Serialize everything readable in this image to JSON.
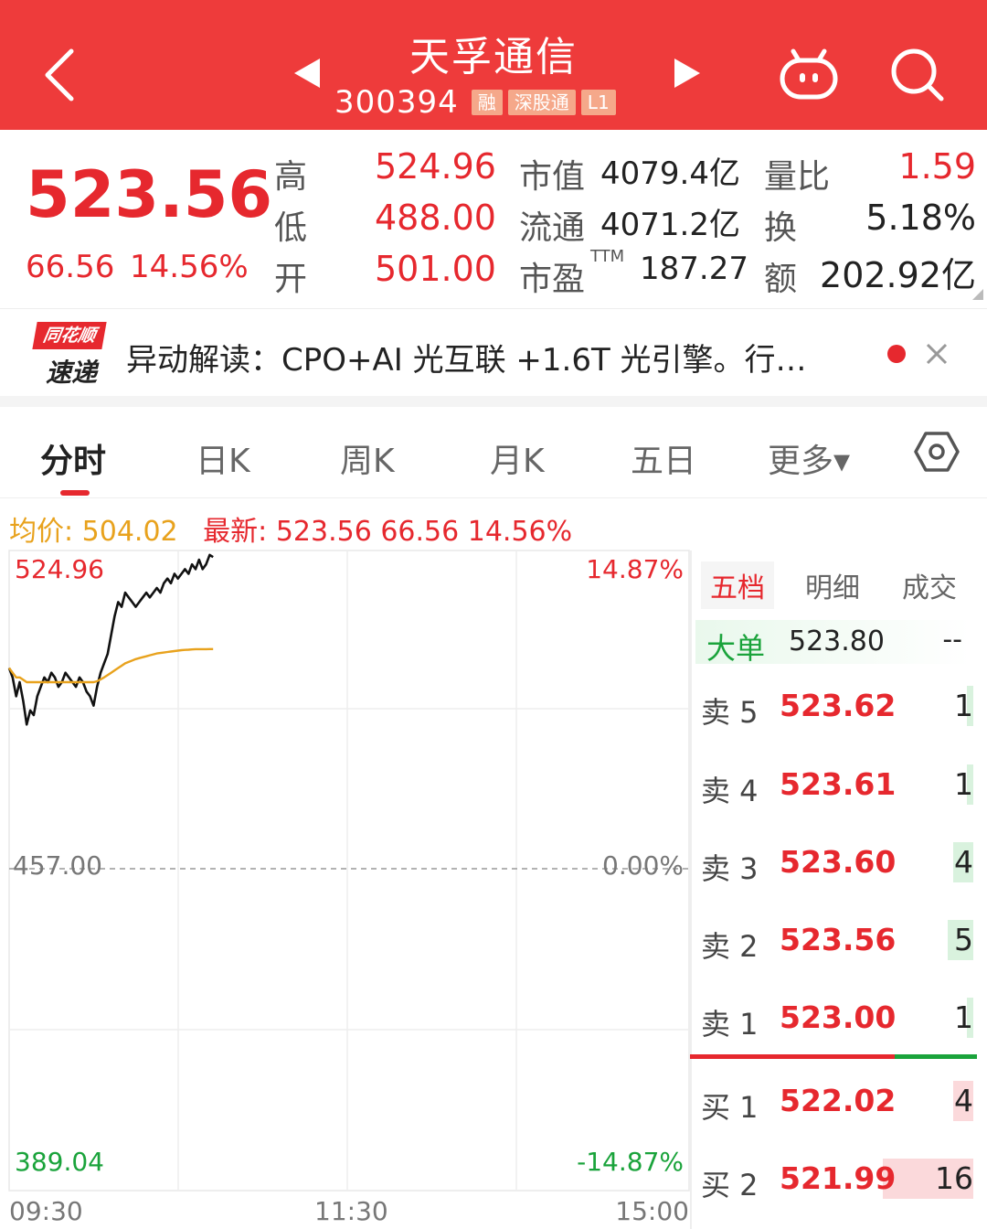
{
  "header": {
    "title": "天孚通信",
    "code": "300394",
    "tags": [
      "融",
      "深股通",
      "L1"
    ]
  },
  "quote": {
    "price": "523.56",
    "change": "66.56",
    "change_pct": "14.56%",
    "high_label": "高",
    "high": "524.96",
    "low_label": "低",
    "low": "488.00",
    "open_label": "开",
    "open": "501.00",
    "mktcap_label": "市值",
    "mktcap": "4079.4亿",
    "float_label": "流通",
    "float": "4071.2亿",
    "pe_label": "市盈",
    "pe_sup": "TTM",
    "pe": "187.27",
    "volratio_label": "量比",
    "volratio": "1.59",
    "turnover_label": "换",
    "turnover": "5.18%",
    "amount_label": "额",
    "amount": "202.92亿"
  },
  "news": {
    "logo_top": "同花顺",
    "logo_bottom": "速递",
    "text": "异动解读：CPO+AI 光互联 +1.6T 光引擎。行…"
  },
  "tabs": [
    "分时",
    "日K",
    "周K",
    "月K",
    "五日",
    "更多▾"
  ],
  "legend": {
    "avg": "均价: 504.02",
    "last": "最新: 523.56  66.56  14.56%"
  },
  "chart_data": {
    "type": "line",
    "y_top_label": "524.96",
    "y_mid_label": "457.00",
    "y_bottom_label": "389.04",
    "pct_top_label": "14.87%",
    "pct_mid_label": "0.00%",
    "pct_bottom_label": "-14.87%",
    "x_labels": [
      "09:30",
      "11:30",
      "15:00"
    ],
    "ylim": [
      389.04,
      524.96
    ],
    "prev_close": 457.0,
    "series": [
      {
        "color": "#111111",
        "values": [
          500,
          498,
          494,
          497,
          493,
          488,
          491,
          490,
          494,
          496,
          498,
          497,
          499,
          498,
          496,
          497,
          499,
          498,
          497,
          496,
          498,
          497,
          495,
          494,
          492,
          496,
          499,
          501,
          503,
          507,
          511,
          514,
          513,
          516,
          515,
          514,
          513,
          514,
          515,
          516,
          515,
          516,
          517,
          516,
          518,
          519,
          518,
          520,
          519,
          520,
          521,
          520,
          522,
          521,
          523,
          521,
          522,
          524,
          523.56
        ]
      },
      {
        "color": "#e8a21d",
        "values": [
          500,
          499,
          498,
          498,
          497.5,
          497,
          497,
          497,
          497,
          497,
          497,
          497,
          497,
          497,
          497,
          497,
          497,
          497,
          497,
          497,
          497,
          497,
          497,
          497,
          497,
          497.2,
          497.6,
          498,
          498.5,
          499,
          499.5,
          500,
          500.5,
          501,
          501.3,
          501.6,
          501.9,
          502.1,
          502.3,
          502.5,
          502.7,
          502.9,
          503.1,
          503.2,
          503.3,
          503.4,
          503.5,
          503.6,
          503.7,
          503.8,
          503.85,
          503.9,
          503.95,
          504.0,
          504.0,
          504.0,
          504.01,
          504.02,
          504.02
        ]
      }
    ]
  },
  "book": {
    "tabs": [
      "五档",
      "明细",
      "成交"
    ],
    "big_label": "大单",
    "big_price": "523.80",
    "big_vol": "--",
    "rows": [
      {
        "label": "卖 5",
        "price": "523.62",
        "vol": "1",
        "side": "sell",
        "w": 0.06
      },
      {
        "label": "卖 4",
        "price": "523.61",
        "vol": "1",
        "side": "sell",
        "w": 0.06
      },
      {
        "label": "卖 3",
        "price": "523.60",
        "vol": "4",
        "side": "sell",
        "w": 0.2
      },
      {
        "label": "卖 2",
        "price": "523.56",
        "vol": "5",
        "side": "sell",
        "w": 0.25
      },
      {
        "label": "卖 1",
        "price": "523.00",
        "vol": "1",
        "side": "sell",
        "w": 0.06
      },
      {
        "label": "买 1",
        "price": "522.02",
        "vol": "4",
        "side": "buy",
        "w": 0.2
      },
      {
        "label": "买 2",
        "price": "521.99",
        "vol": "16",
        "side": "buy",
        "w": 0.9
      }
    ]
  },
  "colors": {
    "accent": "#ee3b3b",
    "up": "#e6282e",
    "down": "#1aa33b",
    "avg": "#e8a21d"
  }
}
